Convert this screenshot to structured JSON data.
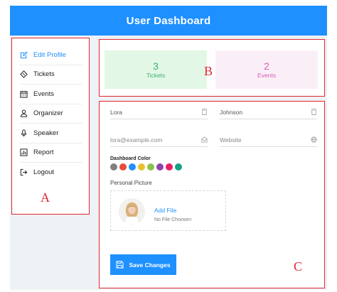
{
  "header": {
    "title": "User Dashboard"
  },
  "sidebar": {
    "items": [
      {
        "label": "Edit Profile",
        "icon": "edit-icon",
        "active": true
      },
      {
        "label": "Tickets",
        "icon": "ticket-icon"
      },
      {
        "label": "Events",
        "icon": "calendar-icon"
      },
      {
        "label": "Organizer",
        "icon": "user-icon"
      },
      {
        "label": "Speaker",
        "icon": "microphone-icon"
      },
      {
        "label": "Report",
        "icon": "chart-icon"
      },
      {
        "label": "Logout",
        "icon": "logout-icon"
      }
    ]
  },
  "stats": {
    "tickets": {
      "value": "3",
      "label": "Tickets",
      "color": "#3cb371"
    },
    "events": {
      "value": "2",
      "label": "Events",
      "color": "#d560b6"
    }
  },
  "form": {
    "first_name": {
      "value": "Lora",
      "icon": "id-card-icon"
    },
    "last_name": {
      "value": "Johnson",
      "icon": "id-card-icon"
    },
    "email": {
      "placeholder": "lora@example.com",
      "icon": "envelope-icon"
    },
    "website": {
      "placeholder": "Website",
      "icon": "globe-icon"
    },
    "color_label": "Dashboard Color",
    "colors": [
      "#808080",
      "#e74c3c",
      "#1e90ff",
      "#e6c12e",
      "#8bc34a",
      "#8e44ad",
      "#e91e63",
      "#16a085"
    ],
    "picture_label": "Personal Picture",
    "add_file": "Add File",
    "no_file": "No File Choosen",
    "save_label": "Save Changes"
  },
  "markers": {
    "a": "A",
    "b": "B",
    "c": "C"
  },
  "colors": {
    "accent": "#1e90ff",
    "annotation": "#e0262f"
  }
}
